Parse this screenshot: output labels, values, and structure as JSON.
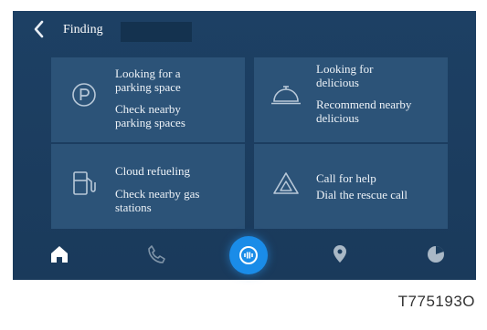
{
  "header": {
    "title": "Finding"
  },
  "cards": [
    {
      "title": "Looking for a\nparking space",
      "subtitle": "Check nearby\nparking spaces",
      "icon": "parking-icon"
    },
    {
      "title": "Looking for\ndelicious",
      "subtitle": "Recommend nearby\ndelicious",
      "icon": "food-cloche-icon"
    },
    {
      "title": "Cloud refueling",
      "subtitle": "Check nearby gas\nstations",
      "icon": "gas-pump-icon"
    },
    {
      "title": "Call for help",
      "subtitle": "Dial the rescue call",
      "icon": "warning-triangle-icon"
    }
  ],
  "nav": [
    {
      "icon": "home-icon"
    },
    {
      "icon": "phone-icon"
    },
    {
      "icon": "voice-assistant-icon",
      "active": true
    },
    {
      "icon": "map-pin-icon"
    },
    {
      "icon": "pie-chart-icon"
    }
  ],
  "caption": "T775193O",
  "colors": {
    "screen_bg": "#1b3d5e",
    "card_bg": "#2c5378",
    "active_nav": "#1a8ce8"
  }
}
